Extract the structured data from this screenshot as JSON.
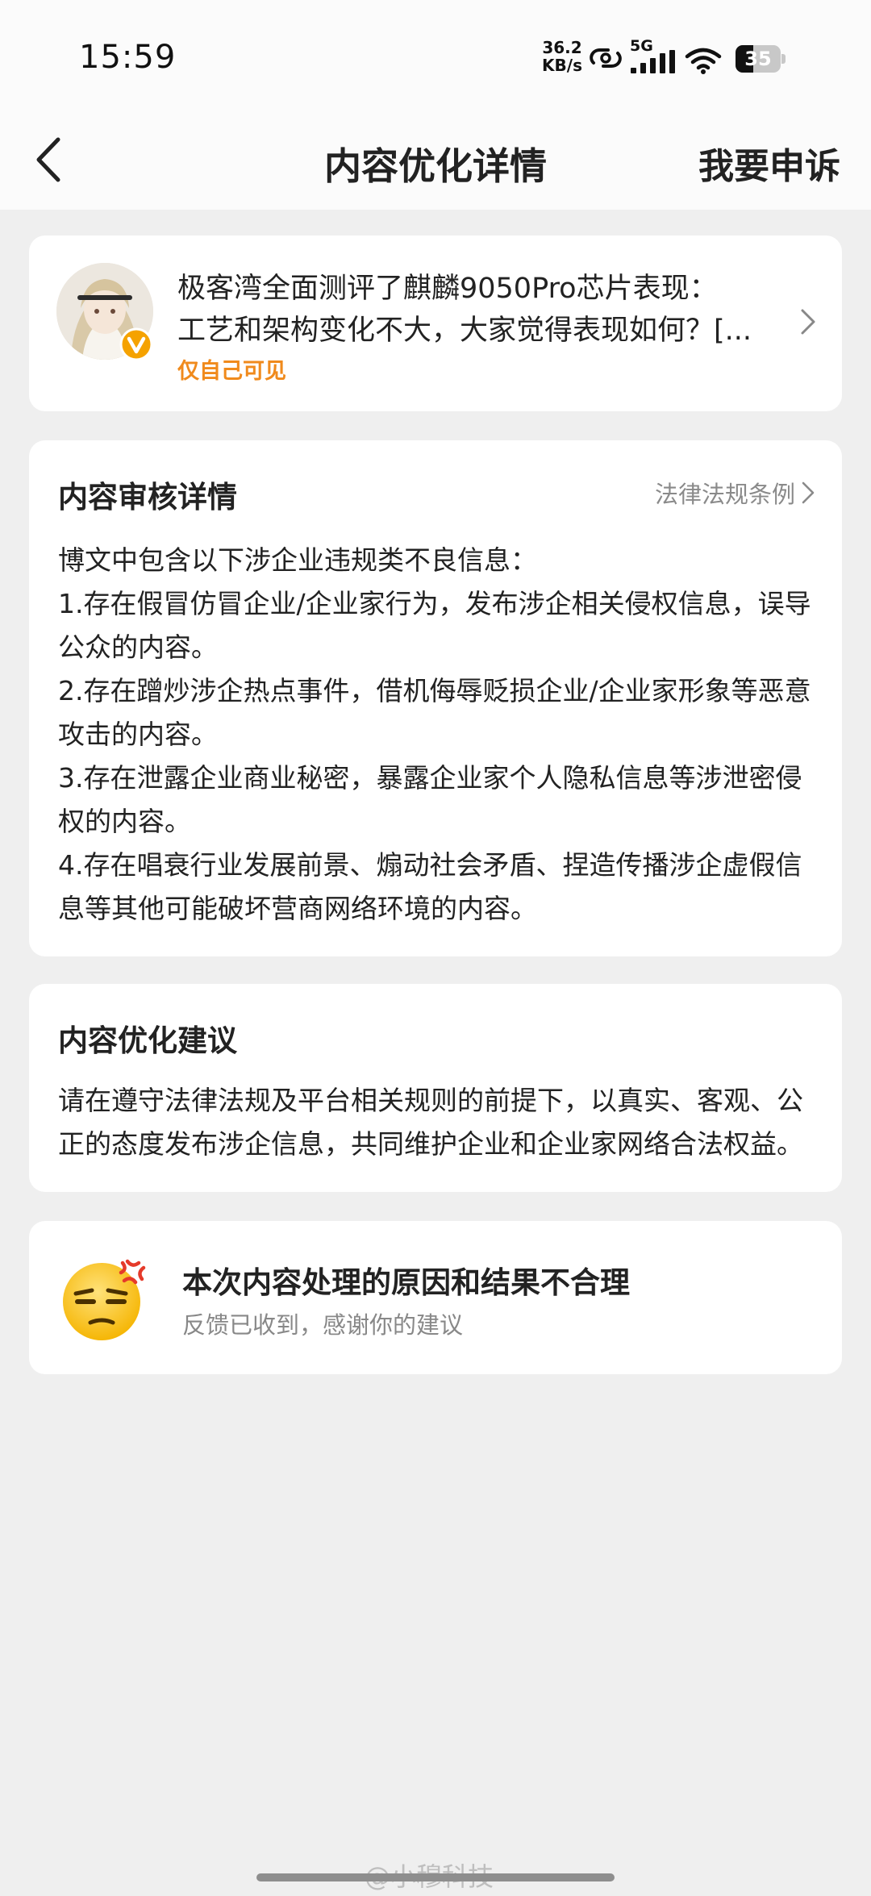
{
  "status_bar": {
    "time": "15:59",
    "net_speed_value": "36.2",
    "net_speed_unit": "KB/s",
    "network_type": "5G",
    "battery": "35",
    "icons": [
      "hotspot-link-icon",
      "signal-icon",
      "wifi-icon",
      "battery-icon"
    ]
  },
  "header": {
    "title": "内容优化详情",
    "appeal_label": "我要申诉",
    "back_icon": "back-arrow-icon"
  },
  "post": {
    "text_line1": "极客湾全面测评了麒麟9050Pro芯片表现：",
    "text_line2": "工艺和架构变化不大，大家觉得表现如何？[...",
    "visibility": "仅自己可见",
    "badge_color": "#f5a200"
  },
  "review": {
    "title": "内容审核详情",
    "law_link": "法律法规条例",
    "intro": "博文中包含以下涉企业违规类不良信息：",
    "items": [
      "1.存在假冒仿冒企业/企业家行为，发布涉企相关侵权信息，误导公众的内容。",
      "2.存在蹭炒涉企热点事件，借机侮辱贬损企业/企业家形象等恶意攻击的内容。",
      "3.存在泄露企业商业秘密，暴露企业家个人隐私信息等涉泄密侵权的内容。",
      "4.存在唱衰行业发展前景、煽动社会矛盾、捏造传播涉企虚假信息等其他可能破坏营商网络环境的内容。"
    ]
  },
  "suggestion": {
    "title": "内容优化建议",
    "body": "请在遵守法律法规及平台相关规则的前提下，以真实、客观、公正的态度发布涉企信息，共同维护企业和企业家网络合法权益。"
  },
  "feedback": {
    "title": "本次内容处理的原因和结果不合理",
    "subtitle": "反馈已收到，感谢你的建议",
    "icon": "annoyed-face-emoji-icon"
  },
  "watermark": "@小穆科技",
  "colors": {
    "accent_orange": "#f08a1c",
    "background": "#efefef",
    "card": "#ffffff"
  }
}
